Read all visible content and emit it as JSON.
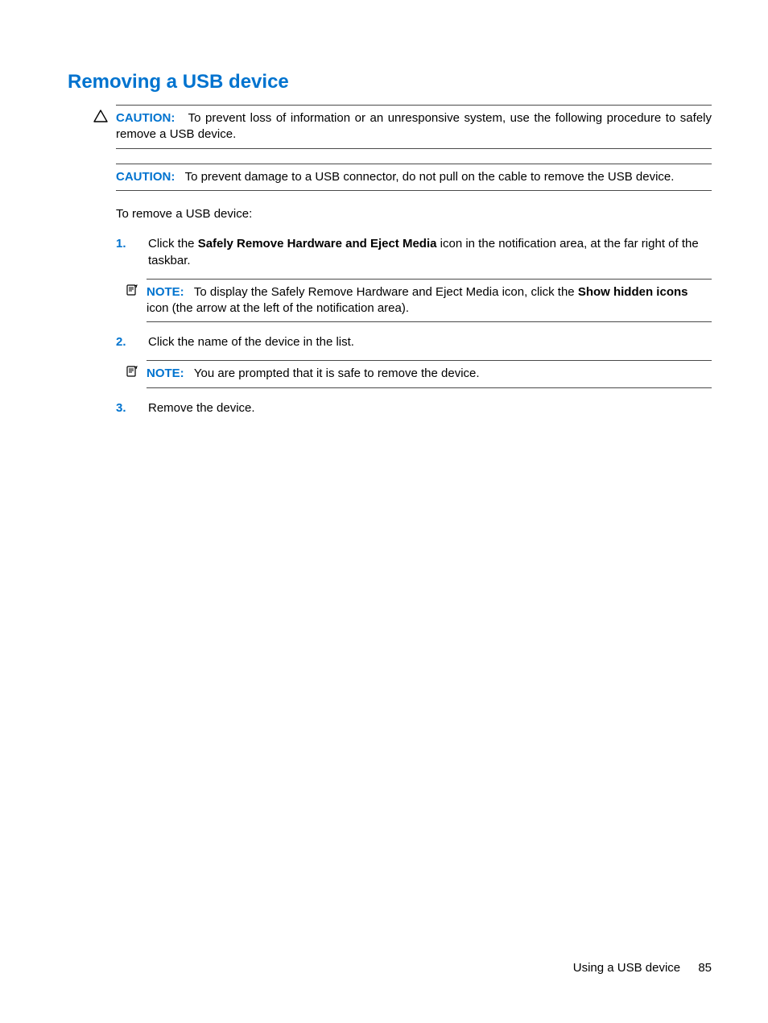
{
  "title": "Removing a USB device",
  "caution1": {
    "label": "CAUTION:",
    "text": "To prevent loss of information or an unresponsive system, use the following procedure to safely remove a USB device."
  },
  "caution2": {
    "label": "CAUTION:",
    "text": "To prevent damage to a USB connector, do not pull on the cable to remove the USB device."
  },
  "intro": "To remove a USB device:",
  "step1": {
    "pre": "Click the ",
    "bold": "Safely Remove Hardware and Eject Media",
    "post": " icon in the notification area, at the far right of the taskbar."
  },
  "note1": {
    "label": "NOTE:",
    "pre": "To display the Safely Remove Hardware and Eject Media icon, click the ",
    "bold": "Show hidden icons",
    "post": " icon (the arrow at the left of the notification area)."
  },
  "step2": "Click the name of the device in the list.",
  "note2": {
    "label": "NOTE:",
    "text": "You are prompted that it is safe to remove the device."
  },
  "step3": "Remove the device.",
  "footer": {
    "chapter": "Using a USB device",
    "page": "85"
  }
}
